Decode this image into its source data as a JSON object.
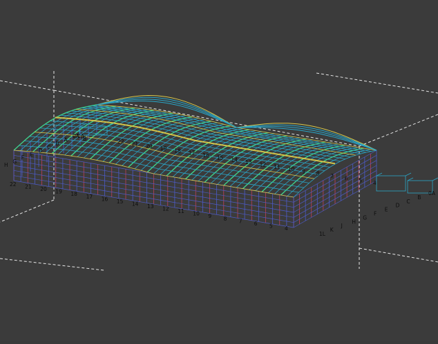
{
  "viewport": {
    "background": "#3b3b3b",
    "colors": {
      "roof_mesh": "#2aa7c9",
      "roof_highlight": "#3fd08a",
      "yellow_member": "#d9c84a",
      "wall_mesh": "#4d5bc8",
      "wall_red": "#c0405a",
      "label": "#0d0d0d"
    }
  },
  "grid_labels": {
    "front_numbers": [
      "22",
      "21",
      "20",
      "19",
      "18",
      "17",
      "16",
      "15",
      "14",
      "13",
      "12",
      "11",
      "10",
      "9",
      "8",
      "7",
      "6",
      "5",
      "4"
    ],
    "top_numbers": [
      "22",
      "21",
      "20",
      "19",
      "18",
      "17",
      "16",
      "15",
      "14",
      "13",
      "12",
      "11",
      "10",
      "9",
      "8",
      "7",
      "6",
      "5",
      "4"
    ],
    "left_letters": [
      "H",
      "G",
      "F",
      "E",
      "D",
      "C",
      "B",
      "A",
      "0A"
    ],
    "right_letters": [
      "1L",
      "K",
      "J",
      "H",
      "G",
      "F",
      "E",
      "D",
      "C",
      "B",
      "0A"
    ],
    "top_left_letters": [
      "0A",
      "B"
    ]
  }
}
